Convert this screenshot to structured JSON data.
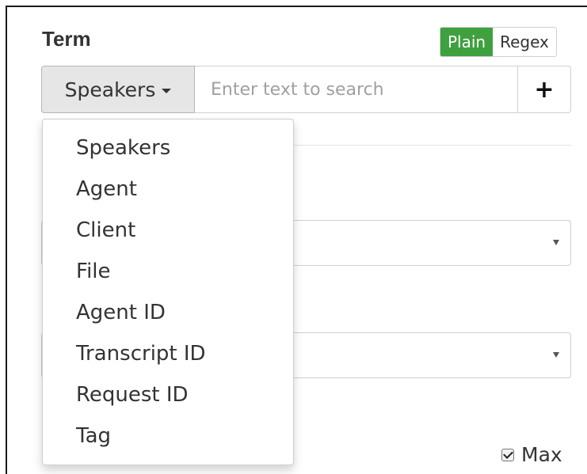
{
  "term": {
    "title": "Term",
    "mode_plain": "Plain",
    "mode_regex": "Regex",
    "active_mode": "Plain"
  },
  "search": {
    "field_selector_label": "Speakers",
    "placeholder": "Enter text to search",
    "value": "",
    "add_label": "+"
  },
  "dropdown": {
    "open": true,
    "items": [
      {
        "label": "Speakers"
      },
      {
        "label": "Agent"
      },
      {
        "label": "Client"
      },
      {
        "label": "File"
      },
      {
        "label": "Agent ID"
      },
      {
        "label": "Transcript ID"
      },
      {
        "label": "Request ID"
      },
      {
        "label": "Tag"
      }
    ]
  },
  "options": {
    "max_label": "Max",
    "max_checked": true
  },
  "colors": {
    "accent_green": "#3fa03f",
    "button_gray": "#e6e6e6"
  }
}
